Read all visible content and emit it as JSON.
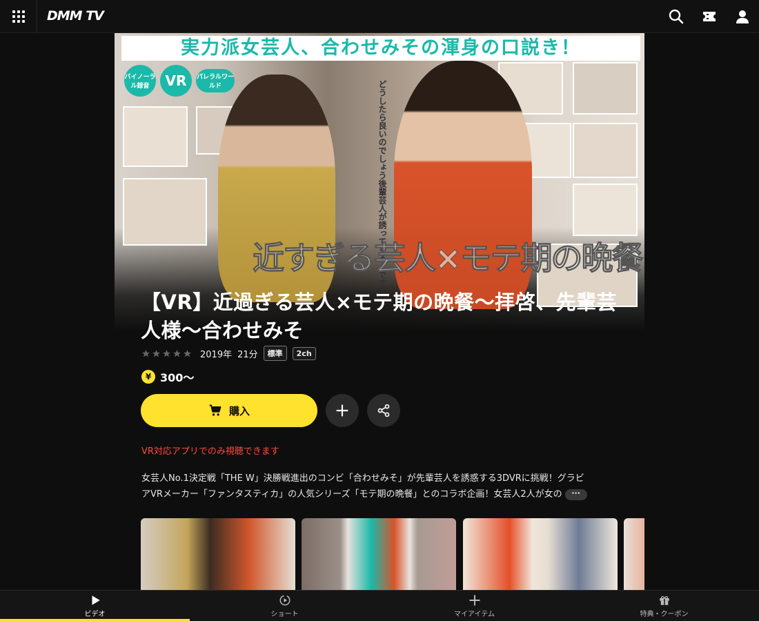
{
  "header": {
    "logo": "DMM TV",
    "icons": [
      "grid-icon",
      "search-icon",
      "ticket-icon",
      "user-icon"
    ]
  },
  "hero": {
    "banner_text": "実力派女芸人、合わせみその渾身の口説き！",
    "badge_binaural": "バイノーラル録音",
    "badge_vr": "VR",
    "badge_parallel": "パレラルワールド",
    "vertical_caption": "どうしたら良いのでしょう後輩芸人が誘ってくるんです",
    "art_title": "近すぎる芸人×モテ期の晩餐"
  },
  "product": {
    "title": "【VR】近過ぎる芸人×モテ期の晩餐～拝啓、先輩芸人様～合わせみそ",
    "rating": 0,
    "year": "2019年",
    "duration": "21分",
    "tags": [
      "標準",
      "2ch"
    ],
    "price_symbol": "¥",
    "price": "300～",
    "buy_label": "購入",
    "notice": "VR対応アプリでのみ視聴できます",
    "description_line1": "女芸人No.1決定戦「THE W」決勝戦進出のコンビ「合わせみそ」が先輩芸人を誘惑する3DVRに挑戦！グラビ",
    "description_line2": "アVRメーカー「ファンタスティカ」の人気シリーズ「モテ期の晩餐」とのコラボ企画！女芸人2人が女の",
    "more_label": "···"
  },
  "colors": {
    "accent": "#ffe22e",
    "notice": "#ff4a3d",
    "teal": "#1bb9a9",
    "background": "#0e0e0e"
  },
  "bottom_nav": [
    {
      "label": "ビデオ",
      "icon": "play-icon",
      "active": true
    },
    {
      "label": "ショート",
      "icon": "short-video-icon",
      "active": false
    },
    {
      "label": "マイアイテム",
      "icon": "plus-icon",
      "active": false
    },
    {
      "label": "特典・クーポン",
      "icon": "gift-icon",
      "active": false
    }
  ]
}
